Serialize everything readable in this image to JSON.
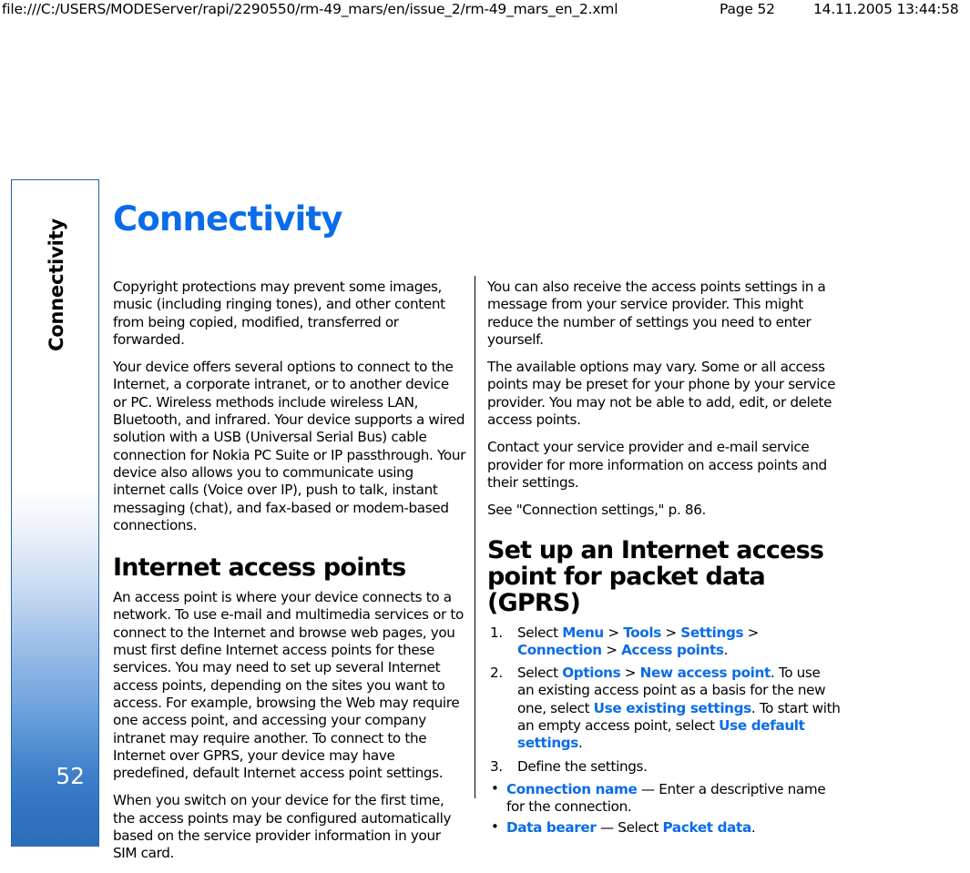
{
  "print_header": {
    "url": "file:///C:/USERS/MODEServer/rapi/2290550/rm-49_mars/en/issue_2/rm-49_mars_en_2.xml",
    "page": "Page 52",
    "datetime": "14.11.2005 13:44:58"
  },
  "sidebar": {
    "chapter_tab_label": "Connectivity",
    "page_number": "52",
    "accent_color": "#2b6dba",
    "border_color": "#1f63a8"
  },
  "page": {
    "chapter_title": "Connectivity",
    "title_color": "#0a6ce8"
  },
  "left_column": {
    "paragraphs": [
      "Copyright protections may prevent some images, music (including ringing tones), and other content from being copied, modified, transferred or forwarded.",
      "Your device offers several options to connect to the Internet, a corporate intranet, or to another device or PC. Wireless methods include wireless LAN, Bluetooth, and infrared. Your device supports a wired solution with a USB (Universal Serial Bus) cable connection for Nokia PC Suite or IP passthrough. Your device also allows you to communicate using internet calls (Voice over IP), push to talk, instant messaging (chat), and fax-based or modem-based connections."
    ],
    "section_heading": "Internet access points",
    "section_paragraphs": [
      "An access point is where your device connects to a network. To use e-mail and multimedia services or to connect to the Internet and browse web pages, you must first define Internet access points for these services. You may need to set up several Internet access points, depending on the sites you want to access. For example, browsing the Web may require one access point, and accessing your company intranet may require another. To connect to the Internet over GPRS, your device may have predefined, default Internet access point settings.",
      "When you switch on your device for the first time, the access points may be configured automatically based on the service provider information in your SIM card."
    ]
  },
  "right_column": {
    "paragraphs": [
      "You can also receive the access points settings in a message from your service provider. This might reduce the number of settings you need to enter yourself.",
      "The available options may vary. Some or all access points may be preset for your phone by your service provider. You may not be able to add, edit, or delete access points.",
      "Contact your service provider and e-mail service provider for more information on access points and their settings.",
      "See \"Connection settings,\" p. 86."
    ],
    "section_heading": "Set up an Internet access point for packet data (GPRS)",
    "steps": [
      {
        "number": "1.",
        "parts": [
          {
            "t": "Select ",
            "k": "plain"
          },
          {
            "t": "Menu",
            "k": "ui"
          },
          {
            "t": " > ",
            "k": "sep"
          },
          {
            "t": "Tools",
            "k": "ui"
          },
          {
            "t": " > ",
            "k": "sep"
          },
          {
            "t": "Settings",
            "k": "ui"
          },
          {
            "t": " > ",
            "k": "sep"
          },
          {
            "t": "Connection",
            "k": "ui"
          },
          {
            "t": " > ",
            "k": "sep"
          },
          {
            "t": "Access points",
            "k": "ui"
          },
          {
            "t": ".",
            "k": "plain"
          }
        ]
      },
      {
        "number": "2.",
        "parts": [
          {
            "t": "Select ",
            "k": "plain"
          },
          {
            "t": "Options",
            "k": "ui"
          },
          {
            "t": " > ",
            "k": "sep"
          },
          {
            "t": "New access point",
            "k": "ui"
          },
          {
            "t": ". To use an existing access point as a basis for the new one, select ",
            "k": "plain"
          },
          {
            "t": "Use existing settings",
            "k": "ui"
          },
          {
            "t": ". To start with an empty access point, select ",
            "k": "plain"
          },
          {
            "t": "Use default settings",
            "k": "ui"
          },
          {
            "t": ".",
            "k": "plain"
          }
        ]
      },
      {
        "number": "3.",
        "parts": [
          {
            "t": "Define the settings.",
            "k": "plain"
          }
        ]
      }
    ],
    "bullets": [
      {
        "marker": "•",
        "parts": [
          {
            "t": "Connection name",
            "k": "ui"
          },
          {
            "t": " — Enter a descriptive name for the connection.",
            "k": "plain"
          }
        ]
      },
      {
        "marker": "•",
        "parts": [
          {
            "t": "Data bearer",
            "k": "ui"
          },
          {
            "t": " — Select ",
            "k": "plain"
          },
          {
            "t": "Packet data",
            "k": "ui"
          },
          {
            "t": ".",
            "k": "plain"
          }
        ]
      }
    ]
  }
}
